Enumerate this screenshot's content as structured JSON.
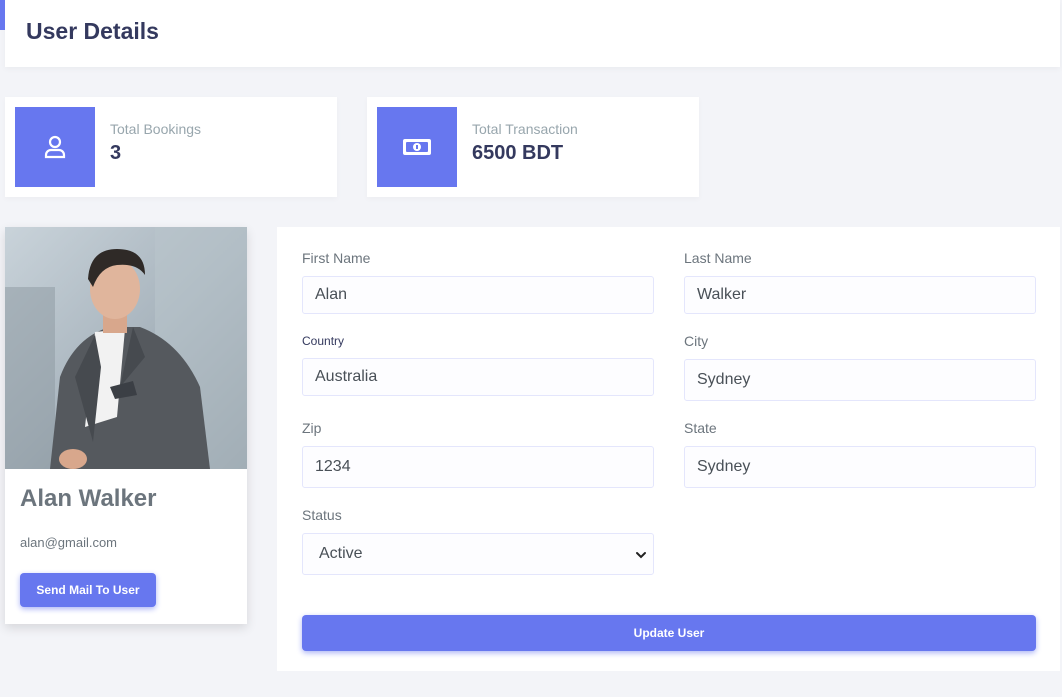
{
  "header": {
    "title": "User Details"
  },
  "stats": [
    {
      "label": "Total Bookings",
      "value": "3",
      "icon": "user-icon"
    },
    {
      "label": "Total Transaction",
      "value": "6500 BDT",
      "icon": "money-icon"
    }
  ],
  "profile": {
    "name": "Alan Walker",
    "email": "alan@gmail.com",
    "send_mail_label": "Send Mail To User",
    "photo_icon": "profile-photo"
  },
  "form": {
    "first_name": {
      "label": "First Name",
      "value": "Alan"
    },
    "last_name": {
      "label": "Last Name",
      "value": "Walker"
    },
    "country": {
      "label": "Country",
      "value": "Australia"
    },
    "city": {
      "label": "City",
      "value": "Sydney"
    },
    "zip": {
      "label": "Zip",
      "value": "1234"
    },
    "state": {
      "label": "State",
      "value": "Sydney"
    },
    "status": {
      "label": "Status",
      "value": "Active"
    },
    "submit_label": "Update User"
  },
  "colors": {
    "accent": "#6777ef",
    "background": "#f3f4f8",
    "heading": "#34395e"
  }
}
